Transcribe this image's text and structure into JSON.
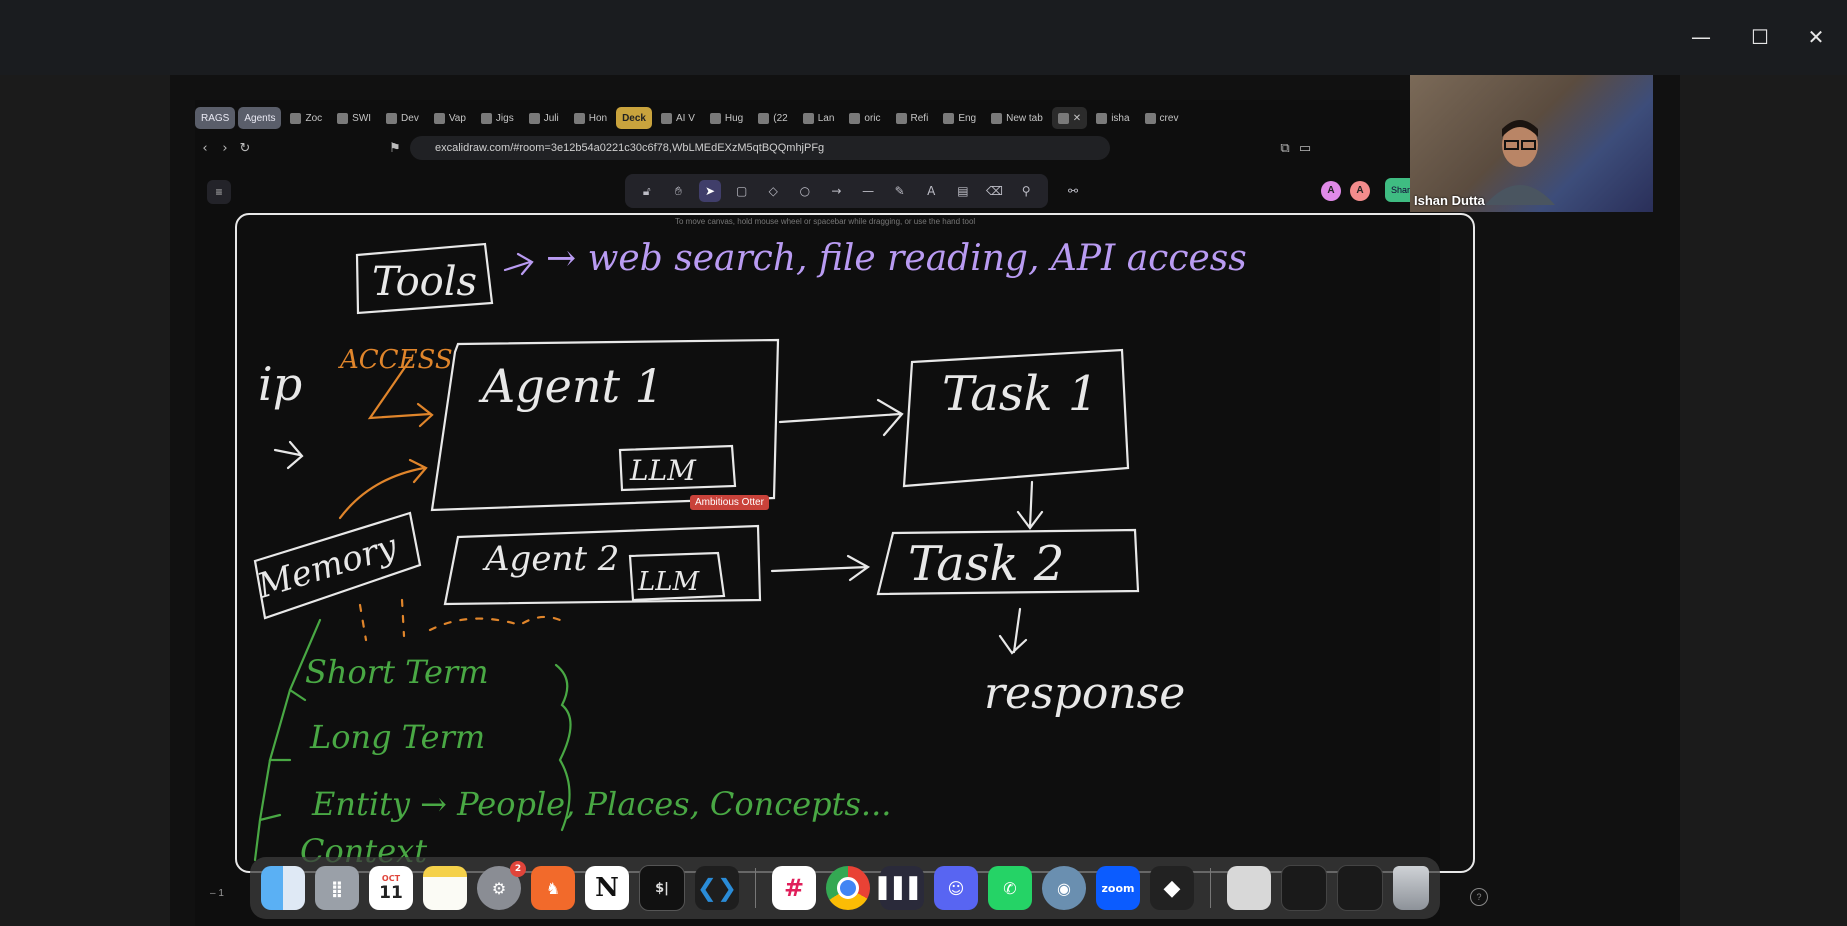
{
  "window": {
    "minimize_glyph": "—",
    "maximize_glyph": "☐",
    "close_glyph": "✕"
  },
  "browser": {
    "tabs": [
      {
        "label": "RAGS",
        "kind": "grp"
      },
      {
        "label": "Agents",
        "kind": "grp"
      },
      {
        "label": "Zoc",
        "kind": "tab"
      },
      {
        "label": "SWI",
        "kind": "tab"
      },
      {
        "label": "Dev",
        "kind": "tab"
      },
      {
        "label": "Vap",
        "kind": "tab"
      },
      {
        "label": "Jigs",
        "kind": "tab"
      },
      {
        "label": "Juli",
        "kind": "tab"
      },
      {
        "label": "Hon",
        "kind": "tab"
      },
      {
        "label": "Deck",
        "kind": "deck"
      },
      {
        "label": "AI V",
        "kind": "tab"
      },
      {
        "label": "Hug",
        "kind": "tab"
      },
      {
        "label": "(22",
        "kind": "tab"
      },
      {
        "label": "Lan",
        "kind": "tab"
      },
      {
        "label": "oric",
        "kind": "tab"
      },
      {
        "label": "Refi",
        "kind": "tab"
      },
      {
        "label": "Eng",
        "kind": "tab"
      },
      {
        "label": "New tab",
        "kind": "tab"
      },
      {
        "label": "✕",
        "kind": "active"
      },
      {
        "label": "isha",
        "kind": "tab"
      },
      {
        "label": "crev",
        "kind": "tab"
      }
    ],
    "url": "excalidraw.com/#room=3e12b54a0221c30c6f78,WbLMEdEXzM5qtBQQmhjPFg"
  },
  "excalidraw": {
    "hint": "To move canvas, hold mouse wheel or spacebar while dragging, or use the hand tool",
    "collaborators": [
      "A",
      "A"
    ],
    "share_label": "Shar",
    "cursor_label": "Ambitious Otter",
    "zoom_label": "– 1"
  },
  "whiteboard": {
    "tools": "Tools",
    "tools_list": "→ web search, file reading, API access",
    "access": "ACCESS",
    "ip": "ip",
    "agent1": "Agent 1",
    "agent2": "Agent 2",
    "llm1": "LLM",
    "llm2": "LLM",
    "task1": "Task 1",
    "task2": "Task 2",
    "response": "response",
    "memory": "Memory",
    "mem_short": "Short Term",
    "mem_long": "Long Term",
    "mem_entity": "Entity → People, Places, Concepts...",
    "mem_context": "Context"
  },
  "webcam": {
    "name": "Ishan Dutta"
  },
  "dock": {
    "apps": [
      "finder",
      "launchpad",
      "calendar",
      "notes",
      "settings",
      "brave",
      "notion",
      "terminal",
      "vscode",
      "slack",
      "chrome",
      "audio",
      "discord",
      "whatsapp",
      "proxyman",
      "zoom",
      "cube",
      "preview",
      "window1",
      "window2",
      "trash"
    ],
    "calendar_month": "OCT",
    "calendar_day": "11",
    "settings_badge": "2",
    "zoom_label": "zoom",
    "terminal_label": "$|",
    "notion_label": "N"
  },
  "colors": {
    "ink": "#e8e8e8",
    "purple": "#b99bf2",
    "orange": "#e0852b",
    "green": "#49a844"
  }
}
